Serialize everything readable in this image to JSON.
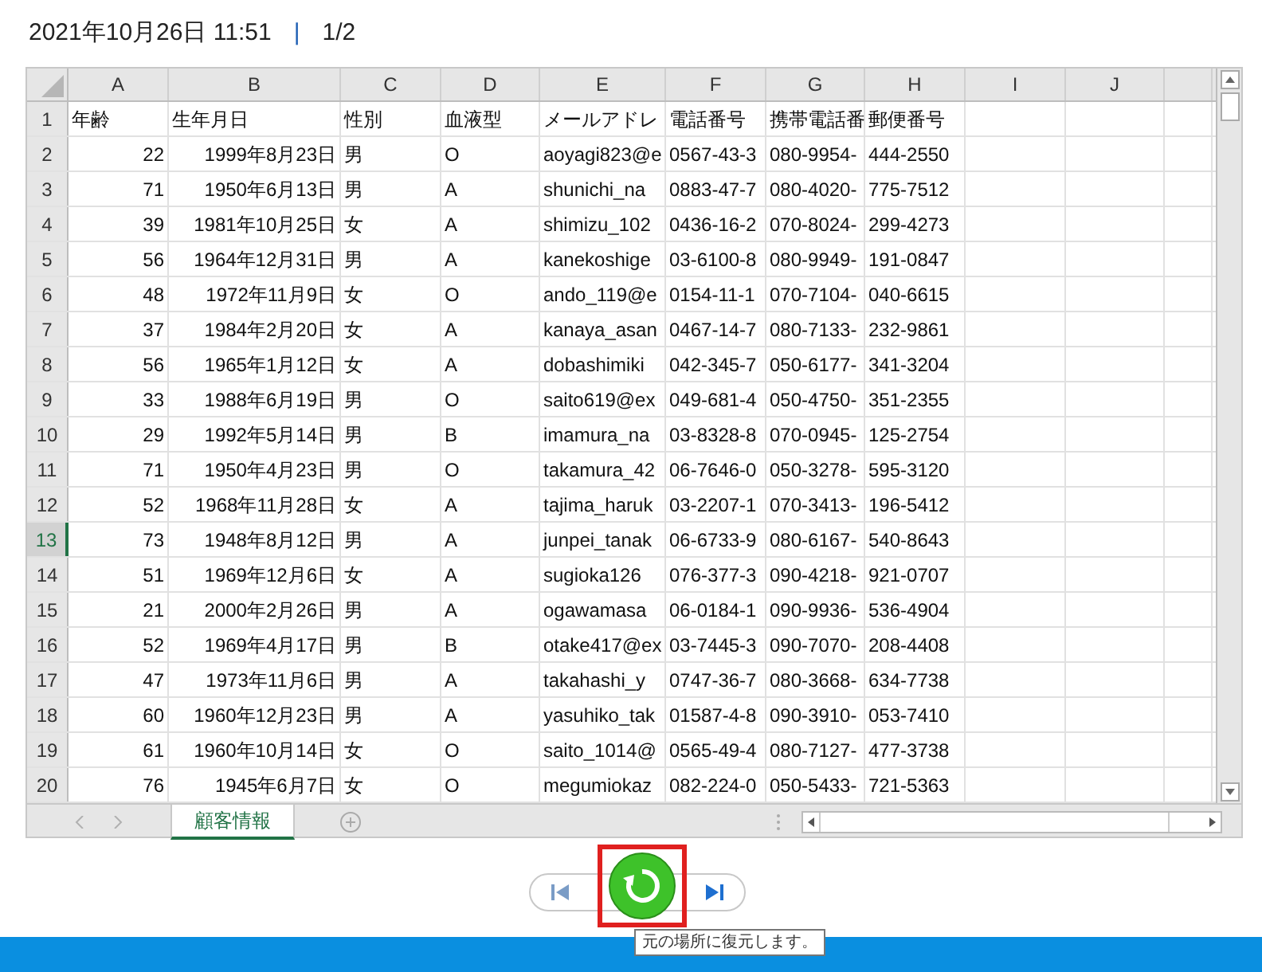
{
  "header": {
    "timestamp": "2021年10月26日 11:51",
    "separator": "|",
    "page": "1/2"
  },
  "sheet": {
    "columns": [
      "A",
      "B",
      "C",
      "D",
      "E",
      "F",
      "G",
      "H",
      "I",
      "J"
    ],
    "rows": [
      {
        "number": "1",
        "selected": false,
        "cells": [
          "年齢",
          "生年月日",
          "性別",
          "血液型",
          "メールアドレ",
          "電話番号",
          "携帯電話番",
          "郵便番号"
        ]
      },
      {
        "number": "2",
        "selected": false,
        "cells": [
          "22",
          "1999年8月23日",
          "男",
          "O",
          "aoyagi823@e",
          "0567-43-3",
          "080-9954-",
          "444-2550"
        ]
      },
      {
        "number": "3",
        "selected": false,
        "cells": [
          "71",
          "1950年6月13日",
          "男",
          "A",
          "shunichi_na",
          "0883-47-7",
          "080-4020-",
          "775-7512"
        ]
      },
      {
        "number": "4",
        "selected": false,
        "cells": [
          "39",
          "1981年10月25日",
          "女",
          "A",
          "shimizu_102",
          "0436-16-2",
          "070-8024-",
          "299-4273"
        ]
      },
      {
        "number": "5",
        "selected": false,
        "cells": [
          "56",
          "1964年12月31日",
          "男",
          "A",
          "kanekoshige",
          "03-6100-8",
          "080-9949-",
          "191-0847"
        ]
      },
      {
        "number": "6",
        "selected": false,
        "cells": [
          "48",
          "1972年11月9日",
          "女",
          "O",
          "ando_119@e",
          "0154-11-1",
          "070-7104-",
          "040-6615"
        ]
      },
      {
        "number": "7",
        "selected": false,
        "cells": [
          "37",
          "1984年2月20日",
          "女",
          "A",
          "kanaya_asan",
          "0467-14-7",
          "080-7133-",
          "232-9861"
        ]
      },
      {
        "number": "8",
        "selected": false,
        "cells": [
          "56",
          "1965年1月12日",
          "女",
          "A",
          "dobashimiki",
          "042-345-7",
          "050-6177-",
          "341-3204"
        ]
      },
      {
        "number": "9",
        "selected": false,
        "cells": [
          "33",
          "1988年6月19日",
          "男",
          "O",
          "saito619@ex",
          "049-681-4",
          "050-4750-",
          "351-2355"
        ]
      },
      {
        "number": "10",
        "selected": false,
        "cells": [
          "29",
          "1992年5月14日",
          "男",
          "B",
          "imamura_na",
          "03-8328-8",
          "070-0945-",
          "125-2754"
        ]
      },
      {
        "number": "11",
        "selected": false,
        "cells": [
          "71",
          "1950年4月23日",
          "男",
          "O",
          "takamura_42",
          "06-7646-0",
          "050-3278-",
          "595-3120"
        ]
      },
      {
        "number": "12",
        "selected": false,
        "cells": [
          "52",
          "1968年11月28日",
          "女",
          "A",
          "tajima_haruk",
          "03-2207-1",
          "070-3413-",
          "196-5412"
        ]
      },
      {
        "number": "13",
        "selected": true,
        "cells": [
          "73",
          "1948年8月12日",
          "男",
          "A",
          "junpei_tanak",
          "06-6733-9",
          "080-6167-",
          "540-8643"
        ]
      },
      {
        "number": "14",
        "selected": false,
        "cells": [
          "51",
          "1969年12月6日",
          "女",
          "A",
          "sugioka126",
          "076-377-3",
          "090-4218-",
          "921-0707"
        ]
      },
      {
        "number": "15",
        "selected": false,
        "cells": [
          "21",
          "2000年2月26日",
          "男",
          "A",
          "ogawamasa",
          "06-0184-1",
          "090-9936-",
          "536-4904"
        ]
      },
      {
        "number": "16",
        "selected": false,
        "cells": [
          "52",
          "1969年4月17日",
          "男",
          "B",
          "otake417@ex",
          "03-7445-3",
          "090-7070-",
          "208-4408"
        ]
      },
      {
        "number": "17",
        "selected": false,
        "cells": [
          "47",
          "1973年11月6日",
          "男",
          "A",
          "takahashi_y",
          "0747-36-7",
          "080-3668-",
          "634-7738"
        ]
      },
      {
        "number": "18",
        "selected": false,
        "cells": [
          "60",
          "1960年12月23日",
          "男",
          "A",
          "yasuhiko_tak",
          "01587-4-8",
          "090-3910-",
          "053-7410"
        ]
      },
      {
        "number": "19",
        "selected": false,
        "cells": [
          "61",
          "1960年10月14日",
          "女",
          "O",
          "saito_1014@",
          "0565-49-4",
          "080-7127-",
          "477-3738"
        ]
      },
      {
        "number": "20",
        "selected": false,
        "cells": [
          "76",
          "1945年6月7日",
          "女",
          "O",
          "megumiokaz",
          "082-224-0",
          "050-5433-",
          "721-5363"
        ]
      }
    ],
    "tabs": [
      {
        "label": "顧客情報",
        "selected": true
      }
    ]
  },
  "tooltip": "元の場所に復元します。"
}
